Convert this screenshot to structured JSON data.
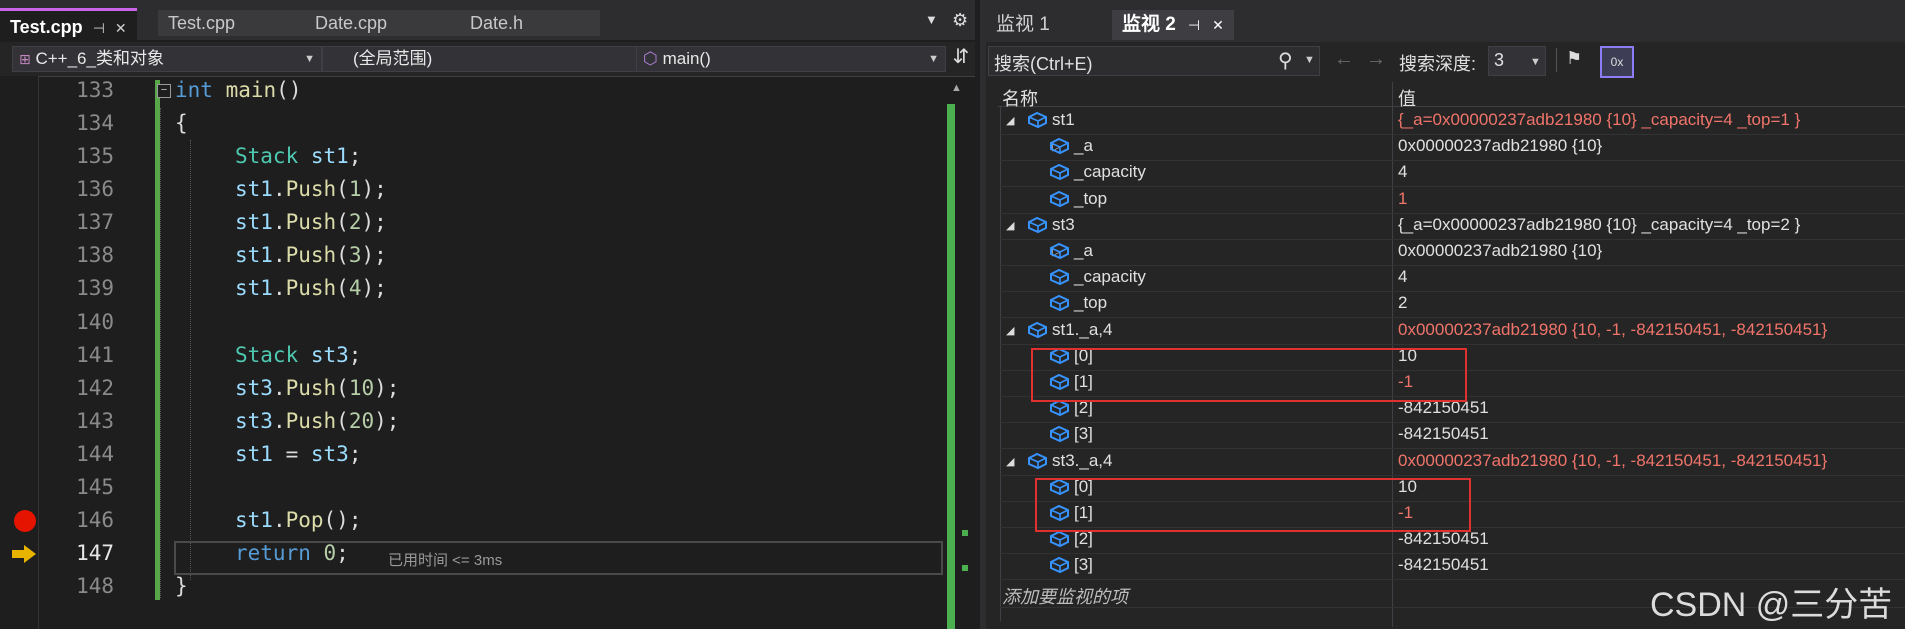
{
  "editor": {
    "tabs": [
      {
        "label": "Test.cpp",
        "active": true,
        "pin": "⊣",
        "close": "✕"
      },
      {
        "label": "Test.cpp",
        "active": false
      },
      {
        "label": "Date.cpp",
        "active": false
      },
      {
        "label": "Date.h",
        "active": false
      }
    ],
    "nav": {
      "project": "C++_6_类和对象",
      "scope": "(全局范围)",
      "member": "main()"
    },
    "lines": [
      {
        "no": "133"
      },
      {
        "no": "134"
      },
      {
        "no": "135"
      },
      {
        "no": "136"
      },
      {
        "no": "137"
      },
      {
        "no": "138"
      },
      {
        "no": "139"
      },
      {
        "no": "140"
      },
      {
        "no": "141"
      },
      {
        "no": "142"
      },
      {
        "no": "143"
      },
      {
        "no": "144"
      },
      {
        "no": "145"
      },
      {
        "no": "146"
      },
      {
        "no": "147"
      },
      {
        "no": "148"
      }
    ],
    "code": {
      "l133_kw": "int",
      "l133_fn": "main",
      "l133_rest": "()",
      "l134": "{",
      "l135_ty": "Stack",
      "l135_var": " st1",
      "l135_rest": ";",
      "l136_obj": "st1",
      "l136_fn": "Push",
      "l136_num": "1",
      "l137_obj": "st1",
      "l137_fn": "Push",
      "l137_num": "2",
      "l138_obj": "st1",
      "l138_fn": "Push",
      "l138_num": "3",
      "l139_obj": "st1",
      "l139_fn": "Push",
      "l139_num": "4",
      "l141_ty": "Stack",
      "l141_var": " st3",
      "l141_rest": ";",
      "l142_obj": "st3",
      "l142_fn": "Push",
      "l142_num": "10",
      "l143_obj": "st3",
      "l143_fn": "Push",
      "l143_num": "20",
      "l144_a": "st1",
      "l144_op": " = ",
      "l144_b": "st3",
      "l144_rest": ";",
      "l146_obj": "st1",
      "l146_fn": "Pop",
      "l146_rest": "();",
      "l147_kw": "return",
      "l147_num": " 0",
      "l147_rest": ";",
      "l148": "}"
    },
    "elapsed": "已用时间 <= 3ms",
    "current_line": "147",
    "breakpoint_line": "146"
  },
  "watch": {
    "tabs": [
      {
        "label": "监视 1",
        "active": false
      },
      {
        "label": "监视 2",
        "active": true,
        "pin": "⊣",
        "close": "✕"
      }
    ],
    "search_placeholder": "搜索(Ctrl+E)",
    "depth_label": "搜索深度:",
    "depth_value": "3",
    "col_name": "名称",
    "col_value": "值",
    "rows": [
      {
        "name": "st1",
        "value": "{_a=0x00000237adb21980 {10} _capacity=4 _top=1 }",
        "changed": true,
        "level": 0,
        "expanded": true
      },
      {
        "name": "_a",
        "value": "0x00000237adb21980 {10}",
        "changed": false,
        "level": 1,
        "expandable": true
      },
      {
        "name": "_capacity",
        "value": "4",
        "changed": false,
        "level": 1
      },
      {
        "name": "_top",
        "value": "1",
        "changed": true,
        "level": 1
      },
      {
        "name": "st3",
        "value": "{_a=0x00000237adb21980 {10} _capacity=4 _top=2 }",
        "changed": false,
        "level": 0,
        "expanded": true
      },
      {
        "name": "_a",
        "value": "0x00000237adb21980 {10}",
        "changed": false,
        "level": 1,
        "expandable": true
      },
      {
        "name": "_capacity",
        "value": "4",
        "changed": false,
        "level": 1
      },
      {
        "name": "_top",
        "value": "2",
        "changed": false,
        "level": 1
      },
      {
        "name": "st1._a,4",
        "value": "0x00000237adb21980 {10, -1, -842150451, -842150451}",
        "changed": true,
        "level": 0,
        "expanded": true
      },
      {
        "name": "[0]",
        "value": "10",
        "changed": false,
        "level": 1
      },
      {
        "name": "[1]",
        "value": "-1",
        "changed": true,
        "level": 1
      },
      {
        "name": "[2]",
        "value": "-842150451",
        "changed": false,
        "level": 1
      },
      {
        "name": "[3]",
        "value": "-842150451",
        "changed": false,
        "level": 1
      },
      {
        "name": "st3._a,4",
        "value": "0x00000237adb21980 {10, -1, -842150451, -842150451}",
        "changed": true,
        "level": 0,
        "expanded": true
      },
      {
        "name": "[0]",
        "value": "10",
        "changed": false,
        "level": 1
      },
      {
        "name": "[1]",
        "value": "-1",
        "changed": true,
        "level": 1
      },
      {
        "name": "[2]",
        "value": "-842150451",
        "changed": false,
        "level": 1
      },
      {
        "name": "[3]",
        "value": "-842150451",
        "changed": false,
        "level": 1
      }
    ],
    "add_item": "添加要监视的项"
  },
  "watermark": "CSDN @三分苦",
  "colors": {
    "accent": "#ca64ea",
    "changed_value": "#f07469",
    "highlight_box": "#e03131",
    "breakpoint": "#e51400"
  }
}
